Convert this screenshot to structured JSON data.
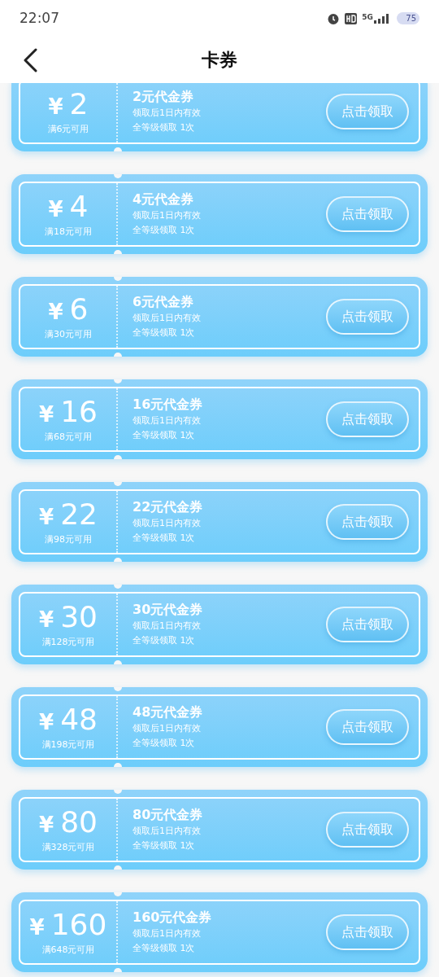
{
  "status_bar": {
    "time": "22:07",
    "network": "5G",
    "battery": "75"
  },
  "header": {
    "title": "卡券"
  },
  "coupons": [
    {
      "currency": "¥",
      "amount": "2",
      "condition": "满6元可用",
      "title": "2元代金券",
      "validity": "领取后1日内有效",
      "limit": "全等级领取 1次",
      "button": "点击领取"
    },
    {
      "currency": "¥",
      "amount": "4",
      "condition": "满18元可用",
      "title": "4元代金券",
      "validity": "领取后1日内有效",
      "limit": "全等级领取 1次",
      "button": "点击领取"
    },
    {
      "currency": "¥",
      "amount": "6",
      "condition": "满30元可用",
      "title": "6元代金券",
      "validity": "领取后1日内有效",
      "limit": "全等级领取 1次",
      "button": "点击领取"
    },
    {
      "currency": "¥",
      "amount": "16",
      "condition": "满68元可用",
      "title": "16元代金券",
      "validity": "领取后1日内有效",
      "limit": "全等级领取 1次",
      "button": "点击领取"
    },
    {
      "currency": "¥",
      "amount": "22",
      "condition": "满98元可用",
      "title": "22元代金券",
      "validity": "领取后1日内有效",
      "limit": "全等级领取 1次",
      "button": "点击领取"
    },
    {
      "currency": "¥",
      "amount": "30",
      "condition": "满128元可用",
      "title": "30元代金券",
      "validity": "领取后1日内有效",
      "limit": "全等级领取 1次",
      "button": "点击领取"
    },
    {
      "currency": "¥",
      "amount": "48",
      "condition": "满198元可用",
      "title": "48元代金券",
      "validity": "领取后1日内有效",
      "limit": "全等级领取 1次",
      "button": "点击领取"
    },
    {
      "currency": "¥",
      "amount": "80",
      "condition": "满328元可用",
      "title": "80元代金券",
      "validity": "领取后1日内有效",
      "limit": "全等级领取 1次",
      "button": "点击领取"
    },
    {
      "currency": "¥",
      "amount": "160",
      "condition": "满648元可用",
      "title": "160元代金券",
      "validity": "领取后1日内有效",
      "limit": "全等级领取 1次",
      "button": "点击领取"
    }
  ]
}
